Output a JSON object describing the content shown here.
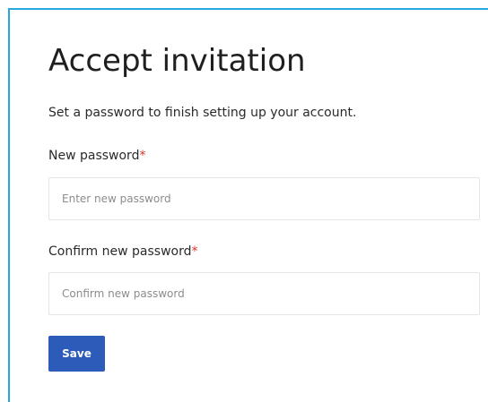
{
  "page": {
    "title": "Accept invitation",
    "subtitle": "Set a password to finish setting up your account."
  },
  "form": {
    "new_password": {
      "label": "New password",
      "required_mark": "*",
      "placeholder": "Enter new password",
      "value": ""
    },
    "confirm_password": {
      "label": "Confirm new password",
      "required_mark": "*",
      "placeholder": "Confirm new password",
      "value": ""
    },
    "save_label": "Save"
  },
  "colors": {
    "accent_border": "#29a8e0",
    "primary_button": "#2d5bb9",
    "required": "#d9342b"
  }
}
